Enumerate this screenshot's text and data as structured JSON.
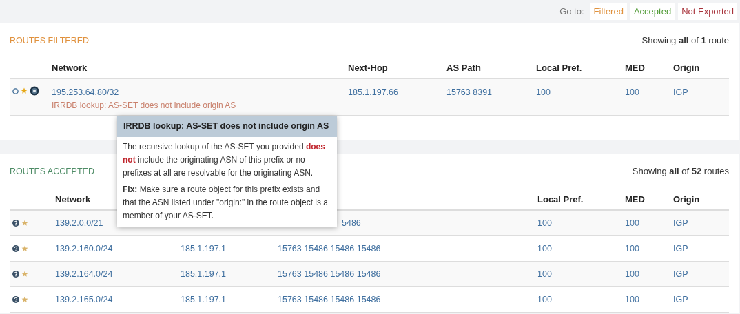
{
  "goto": {
    "label": "Go to:",
    "links": [
      {
        "label": "Filtered",
        "kind": "filtered"
      },
      {
        "label": "Accepted",
        "kind": "accepted"
      },
      {
        "label": "Not Exported",
        "kind": "not_exported"
      }
    ]
  },
  "sections": [
    {
      "kind": "filtered",
      "title": "ROUTES FILTERED",
      "summary": "Showing **all** of **1** route",
      "headers": {
        "network": "Network",
        "next_hop": "Next-Hop",
        "as_path": "AS Path",
        "local_pref": "Local Pref.",
        "med": "MED",
        "origin": "Origin"
      },
      "rows": [
        {
          "network": "195.253.64.80/32",
          "note": "IRRDB lookup: AS-SET does not include origin AS",
          "next_hop": "185.1.197.66",
          "as_path": "15763 8391",
          "local_pref": "100",
          "med": "100",
          "origin": "IGP"
        }
      ]
    },
    {
      "kind": "accepted",
      "title": "ROUTES ACCEPTED",
      "summary": "Showing **all** of **52** routes",
      "headers": {
        "network": "Network",
        "local_pref": "Local Pref.",
        "med": "MED",
        "origin": "Origin"
      },
      "rows": [
        {
          "network": "139.2.0.0/21",
          "as_path": "5486",
          "as_path_cut": true,
          "local_pref": "100",
          "med": "100",
          "origin": "IGP"
        },
        {
          "network": "139.2.160.0/24",
          "next_hop": "185.1.197.1",
          "as_path": "15763 15486 15486 15486",
          "local_pref": "100",
          "med": "100",
          "origin": "IGP"
        },
        {
          "network": "139.2.164.0/24",
          "next_hop": "185.1.197.1",
          "as_path": "15763 15486 15486 15486",
          "local_pref": "100",
          "med": "100",
          "origin": "IGP"
        },
        {
          "network": "139.2.165.0/24",
          "next_hop": "185.1.197.1",
          "as_path": "15763 15486 15486 15486",
          "local_pref": "100",
          "med": "100",
          "origin": "IGP"
        }
      ]
    }
  ],
  "tooltip": {
    "title": "IRRDB lookup: AS-SET does not include origin AS",
    "body": [
      {
        "text": "The recursive lookup of the AS-SET you provided "
      },
      {
        "text": "does not",
        "emphasis": true
      },
      {
        "text": " include the originating ASN of this prefix or no prefixes at all are resolvable for the originating ASN."
      }
    ],
    "fix": "**Fix:** Make sure a route object for this prefix exists and that the ASN listed under \"origin:\" in the route object is a member of your AS-SET."
  }
}
